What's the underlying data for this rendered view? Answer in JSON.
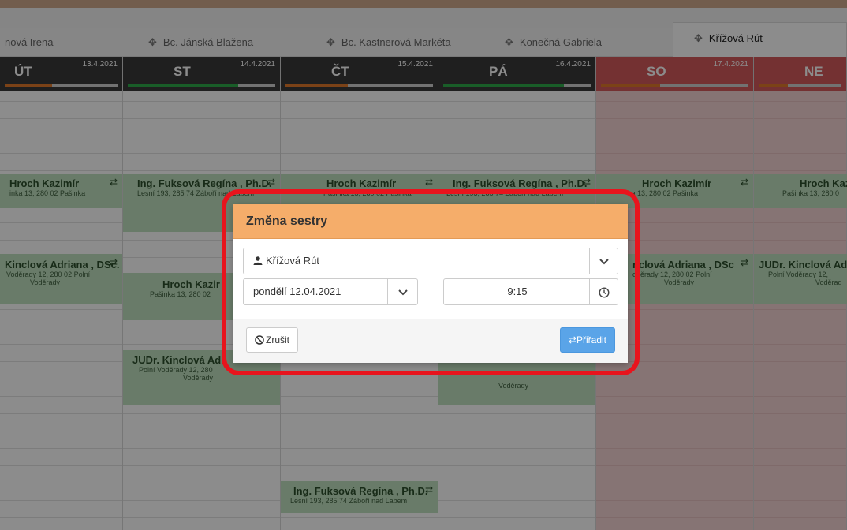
{
  "tabs": [
    {
      "label": "nová Irena",
      "icon": "",
      "active": false
    },
    {
      "label": "Bc. Jánská Blažena",
      "icon": "move-icon",
      "active": false
    },
    {
      "label": "Bc. Kastnerová Markéta",
      "icon": "move-icon",
      "active": false
    },
    {
      "label": "Konečná Gabriela",
      "icon": "move-icon",
      "active": false
    },
    {
      "label": "Křížová Rút",
      "icon": "move-icon",
      "active": true
    }
  ],
  "days": [
    {
      "name": "ÚT",
      "date": "13.4.2021",
      "weekend": false,
      "fill": 0.42,
      "fill_color": "#e0792b"
    },
    {
      "name": "ST",
      "date": "14.4.2021",
      "weekend": false,
      "fill": 0.75,
      "fill_color": "#2faa4a"
    },
    {
      "name": "ČT",
      "date": "15.4.2021",
      "weekend": false,
      "fill": 0.42,
      "fill_color": "#e0792b"
    },
    {
      "name": "PÁ",
      "date": "16.4.2021",
      "weekend": false,
      "fill": 0.82,
      "fill_color": "#2faa4a"
    },
    {
      "name": "SO",
      "date": "17.4.2021",
      "weekend": true,
      "fill": 0.4,
      "fill_color": "#e0792b"
    },
    {
      "name": "NE",
      "date": "",
      "weekend": true,
      "fill": 0.35,
      "fill_color": "#e0792b"
    }
  ],
  "appointments": {
    "hroch_name": "Hroch Kazimír",
    "hroch_addr_cut": "inka 13, 280 02 Pašinka",
    "hroch_addr": "Pašinka 13, 280 02 Pašinka",
    "hroch_addr_st": "Pašinka 13, 280 02",
    "hroch_name_st": "Hroch Kazir",
    "hroch_addr_so": "ka 13, 280 02 Pašinka",
    "hroch_name_ne": "Hroch Kaz",
    "hroch_addr_ne": "Pašinka 13, 280 0",
    "fuks_name": "Ing. Fuksová Regína , Ph.D.",
    "fuks_addr_st": "Lesní 193, 285 74 Záboří nad Labem",
    "fuks_addr": "Lesní 193, 285 74 Záboří nad Labem",
    "kinc_name_cut": "Kinclová Adriana , DSc.",
    "kinc_addr_cut1": "Voděrady 12, 280 02 Polní",
    "kinc_addr_cut2": "Voděrady",
    "kinc_name_so": "nclová Adriana , DSc",
    "kinc_addr_so1": "oděrady 12, 280 02 Polní",
    "kinc_addr_so2": "Voděrady",
    "kinc_name_ne": "JUDr. Kinclová Ad",
    "kinc_addr_ne1": "Polní Voděrady 12,",
    "kinc_addr_ne2": "Voděrad",
    "kinc_name_st": "JUDr. Kinclová Adr",
    "kinc_addr_st1": "Polní Voděrady 12, 280",
    "kinc_addr_st2": "Voděrady",
    "kinc_addr_pa2": "Voděrady",
    "swap_icon": "⇄"
  },
  "modal": {
    "title": "Změna sestry",
    "nurse_select": "Křížová Rút",
    "date_value": "pondělí 12.04.2021",
    "time_value": "9:15",
    "cancel_label": "Zrušit",
    "assign_label": "Přiřadit"
  }
}
